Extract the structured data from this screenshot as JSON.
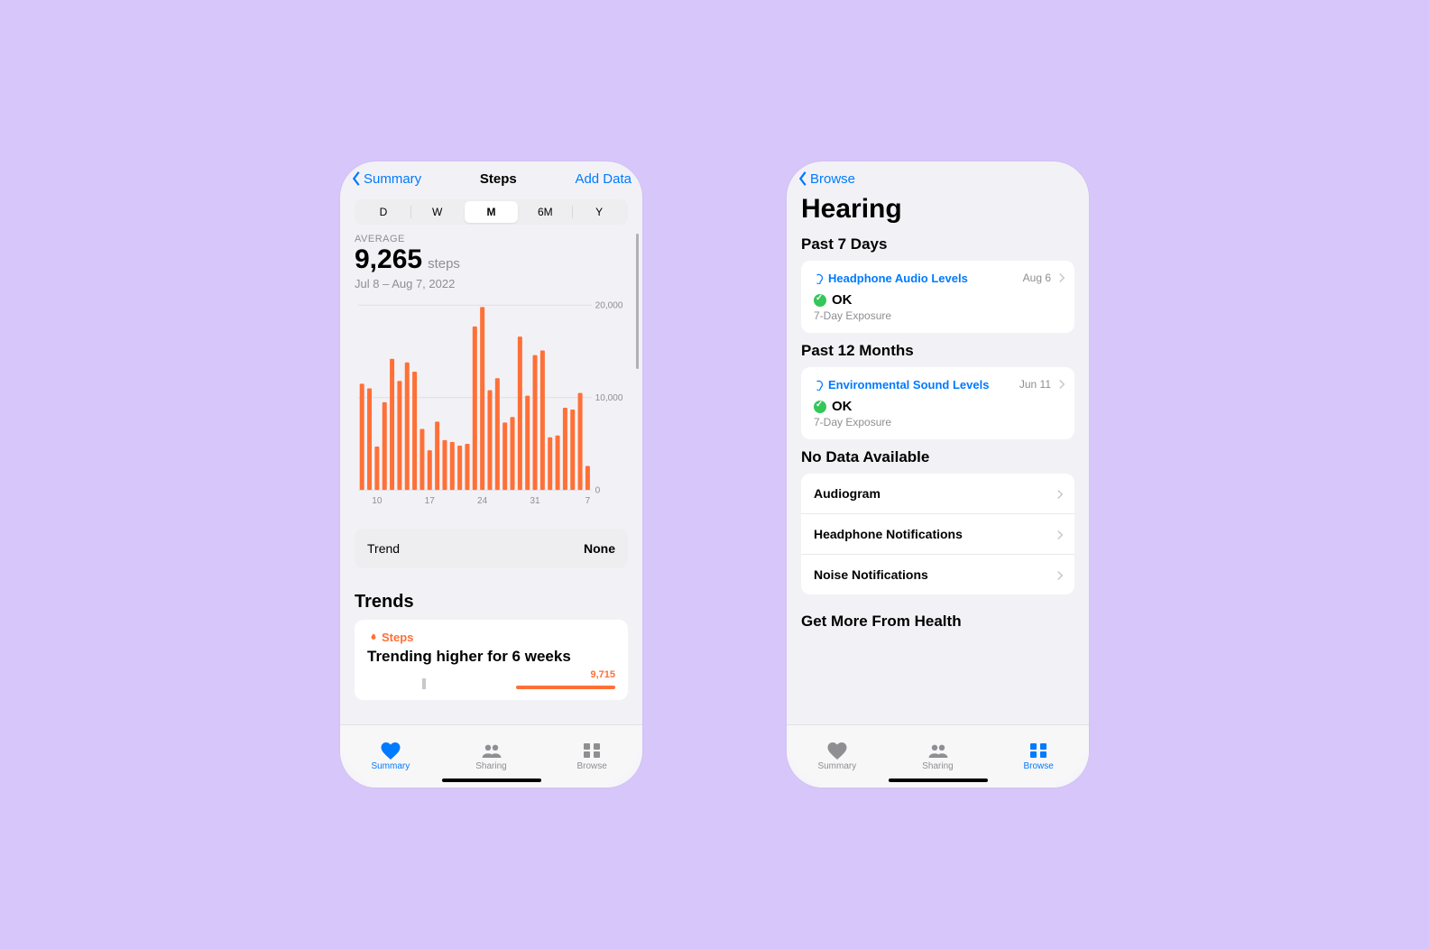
{
  "colors": {
    "accent": "#007aff",
    "orange": "#ff7037",
    "green": "#34c759"
  },
  "tabs": {
    "summary": "Summary",
    "sharing": "Sharing",
    "browse": "Browse"
  },
  "steps": {
    "back": "Summary",
    "title": "Steps",
    "action": "Add Data",
    "seg_items": [
      "D",
      "W",
      "M",
      "6M",
      "Y"
    ],
    "seg_active": "M",
    "avg_label": "AVERAGE",
    "avg_value": "9,265",
    "avg_unit": "steps",
    "date_range": "Jul 8 – Aug 7, 2022",
    "trend_row_label": "Trend",
    "trend_row_value": "None",
    "trends_heading": "Trends",
    "trend_card": {
      "category": "Steps",
      "headline": "Trending higher for 6 weeks",
      "mini_value": "9,715"
    }
  },
  "chart_data": {
    "type": "bar",
    "title": "Steps",
    "xlabel": "",
    "ylabel": "",
    "ylim": [
      0,
      20000
    ],
    "y_ticks": [
      0,
      10000,
      20000
    ],
    "y_tick_labels": [
      "0",
      "10,000",
      "20,000"
    ],
    "x_tick_positions": [
      2,
      9,
      16,
      23,
      30
    ],
    "x_tick_labels": [
      "10",
      "17",
      "24",
      "31",
      "7"
    ],
    "categories": [
      "Jul 8",
      "Jul 9",
      "Jul 10",
      "Jul 11",
      "Jul 12",
      "Jul 13",
      "Jul 14",
      "Jul 15",
      "Jul 16",
      "Jul 17",
      "Jul 18",
      "Jul 19",
      "Jul 20",
      "Jul 21",
      "Jul 22",
      "Jul 23",
      "Jul 24",
      "Jul 25",
      "Jul 26",
      "Jul 27",
      "Jul 28",
      "Jul 29",
      "Jul 30",
      "Jul 31",
      "Aug 1",
      "Aug 2",
      "Aug 3",
      "Aug 4",
      "Aug 5",
      "Aug 6",
      "Aug 7"
    ],
    "values": [
      11500,
      11000,
      4700,
      9500,
      14200,
      11800,
      13800,
      12800,
      6600,
      4300,
      7400,
      5400,
      5200,
      4800,
      5000,
      17700,
      19800,
      10800,
      12100,
      7300,
      7900,
      16600,
      10200,
      14600,
      15100,
      5700,
      5900,
      8900,
      8700,
      10500,
      2600
    ]
  },
  "hearing": {
    "back": "Browse",
    "title": "Hearing",
    "sections": {
      "past7": "Past 7 Days",
      "past12": "Past 12 Months",
      "nodata": "No Data Available",
      "more": "Get More From Health"
    },
    "past7_card": {
      "title": "Headphone Audio Levels",
      "date": "Aug 6",
      "status": "OK",
      "sub": "7-Day Exposure"
    },
    "past12_card": {
      "title": "Environmental Sound Levels",
      "date": "Jun 11",
      "status": "OK",
      "sub": "7-Day Exposure"
    },
    "nodata_items": [
      "Audiogram",
      "Headphone Notifications",
      "Noise Notifications"
    ]
  }
}
